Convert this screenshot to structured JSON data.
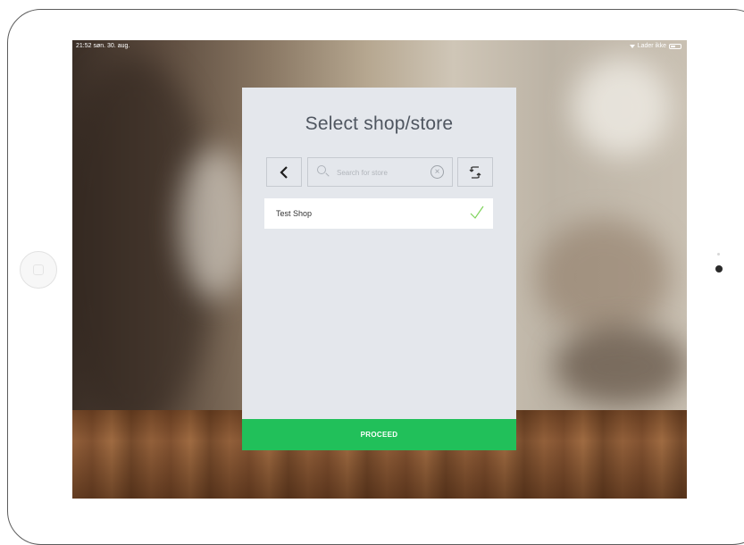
{
  "status_bar": {
    "time_date": "21:52  søn. 30. aug.",
    "charging_status": "Lader ikke",
    "battery_level": 0.45
  },
  "dialog": {
    "title": "Select shop/store",
    "back_icon": "chevron-left-icon",
    "search": {
      "placeholder": "Search for store",
      "value": ""
    },
    "refresh_icon": "refresh-icon",
    "stores": [
      {
        "name": "Test Shop",
        "selected": true
      }
    ],
    "proceed_label": "PROCEED"
  },
  "colors": {
    "accent": "#21c05a",
    "dialog_bg": "#e4e7ec",
    "title": "#4f5660",
    "check": "#7ed35a"
  }
}
